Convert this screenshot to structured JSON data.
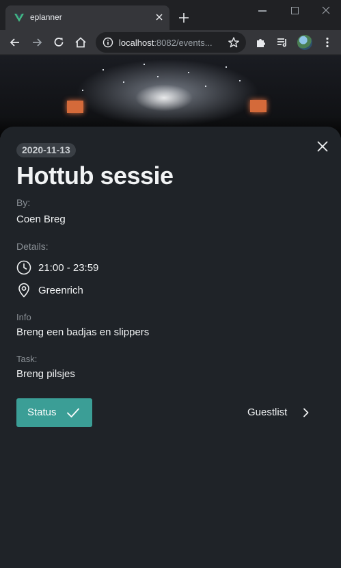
{
  "browser": {
    "tab_title": "eplanner",
    "url_host": "localhost",
    "url_rest": ":8082/events...",
    "icons": [
      "vue-logo-icon",
      "tab-close-icon",
      "new-tab-icon",
      "back-icon",
      "forward-icon",
      "reload-icon",
      "home-icon",
      "info-icon",
      "star-icon",
      "extensions-icon",
      "reading-list-icon",
      "profile-avatar",
      "menu-dots-icon"
    ]
  },
  "event": {
    "date": "2020-11-13",
    "title": "Hottub sessie",
    "by_label": "By:",
    "by_value": "Coen Breg",
    "details_label": "Details:",
    "time": "21:00 - 23:59",
    "location": "Greenrich",
    "info_label": "Info",
    "info_value": "Breng een badjas en slippers",
    "task_label": "Task:",
    "task_value": "Breng pilsjes"
  },
  "actions": {
    "status_label": "Status",
    "guestlist_label": "Guestlist"
  },
  "colors": {
    "panel_bg": "#1f2328",
    "accent": "#3b9e96",
    "text": "#f1f3f4",
    "muted": "#8a9096"
  }
}
